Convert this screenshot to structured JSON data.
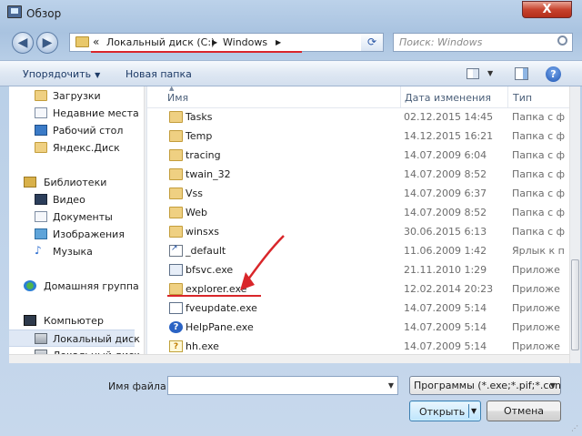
{
  "window": {
    "title": "Обзор",
    "close_glyph": "X"
  },
  "nav_buttons": {
    "back_glyph": "◀",
    "forward_glyph": "▶",
    "refresh_glyph": "⟳"
  },
  "address": {
    "chevron": "«",
    "crumb1": "Локальный диск (C:)",
    "crumb2": "Windows",
    "sep_glyph": "▶",
    "dropdown_glyph": "▼"
  },
  "search": {
    "placeholder": "Поиск: Windows"
  },
  "toolbar": {
    "organize_label": "Упорядочить",
    "new_folder_label": "Новая папка",
    "dd_glyph": "▼",
    "help_glyph": "?"
  },
  "sidebar": {
    "items": [
      {
        "label": "Загрузки",
        "icon": "folder-icon"
      },
      {
        "label": "Недавние места",
        "icon": "recent-icon"
      },
      {
        "label": "Рабочий стол",
        "icon": "desktop-icon"
      },
      {
        "label": "Яндекс.Диск",
        "icon": "folder-icon"
      },
      {
        "label": "Библиотеки",
        "icon": "library-icon"
      },
      {
        "label": "Видео",
        "icon": "video-icon"
      },
      {
        "label": "Документы",
        "icon": "documents-icon"
      },
      {
        "label": "Изображения",
        "icon": "images-icon"
      },
      {
        "label": "Музыка",
        "icon": "music-icon"
      },
      {
        "label": "Домашняя группа",
        "icon": "homegroup-icon"
      },
      {
        "label": "Компьютер",
        "icon": "computer-icon"
      },
      {
        "label": "Локальный диск",
        "icon": "disk-icon"
      },
      {
        "label": "Локальный диск",
        "icon": "disk-icon"
      }
    ],
    "music_glyph": "♪"
  },
  "columns": {
    "name": "Имя",
    "date": "Дата изменения",
    "type": "Тип",
    "sort_glyph": "▲"
  },
  "files": [
    {
      "name": "Tasks",
      "date": "02.12.2015 14:45",
      "type": "Папка с ф",
      "icon": "folder-icon"
    },
    {
      "name": "Temp",
      "date": "14.12.2015 16:21",
      "type": "Папка с ф",
      "icon": "folder-icon"
    },
    {
      "name": "tracing",
      "date": "14.07.2009 6:04",
      "type": "Папка с ф",
      "icon": "folder-icon"
    },
    {
      "name": "twain_32",
      "date": "14.07.2009 8:52",
      "type": "Папка с ф",
      "icon": "folder-icon"
    },
    {
      "name": "Vss",
      "date": "14.07.2009 6:37",
      "type": "Папка с ф",
      "icon": "folder-icon"
    },
    {
      "name": "Web",
      "date": "14.07.2009 8:52",
      "type": "Папка с ф",
      "icon": "folder-icon"
    },
    {
      "name": "winsxs",
      "date": "30.06.2015 6:13",
      "type": "Папка с ф",
      "icon": "folder-icon"
    },
    {
      "name": "_default",
      "date": "11.06.2009 1:42",
      "type": "Ярлык к п",
      "icon": "shortcut-icon"
    },
    {
      "name": "bfsvc.exe",
      "date": "21.11.2010 1:29",
      "type": "Приложе",
      "icon": "exe-icon"
    },
    {
      "name": "explorer.exe",
      "date": "12.02.2014 20:23",
      "type": "Приложе",
      "icon": "explorer-icon"
    },
    {
      "name": "fveupdate.exe",
      "date": "14.07.2009 5:14",
      "type": "Приложе",
      "icon": "exe-icon"
    },
    {
      "name": "HelpPane.exe",
      "date": "14.07.2009 5:14",
      "type": "Приложе",
      "icon": "help-icon"
    },
    {
      "name": "hh.exe",
      "date": "14.07.2009 5:14",
      "type": "Приложе",
      "icon": "hh-icon"
    }
  ],
  "file_icon_glyphs": {
    "help": "?",
    "hh": "?"
  },
  "bottom": {
    "filename_label": "Имя файла:",
    "filename_value": "",
    "filter_label": "Программы (*.exe;*.pif;*.com",
    "open_label": "Открыть",
    "cancel_label": "Отмена",
    "dd_glyph": "▼"
  },
  "colors": {
    "annotation_red": "#d9262a",
    "accent_blue": "#3c7fb1"
  }
}
